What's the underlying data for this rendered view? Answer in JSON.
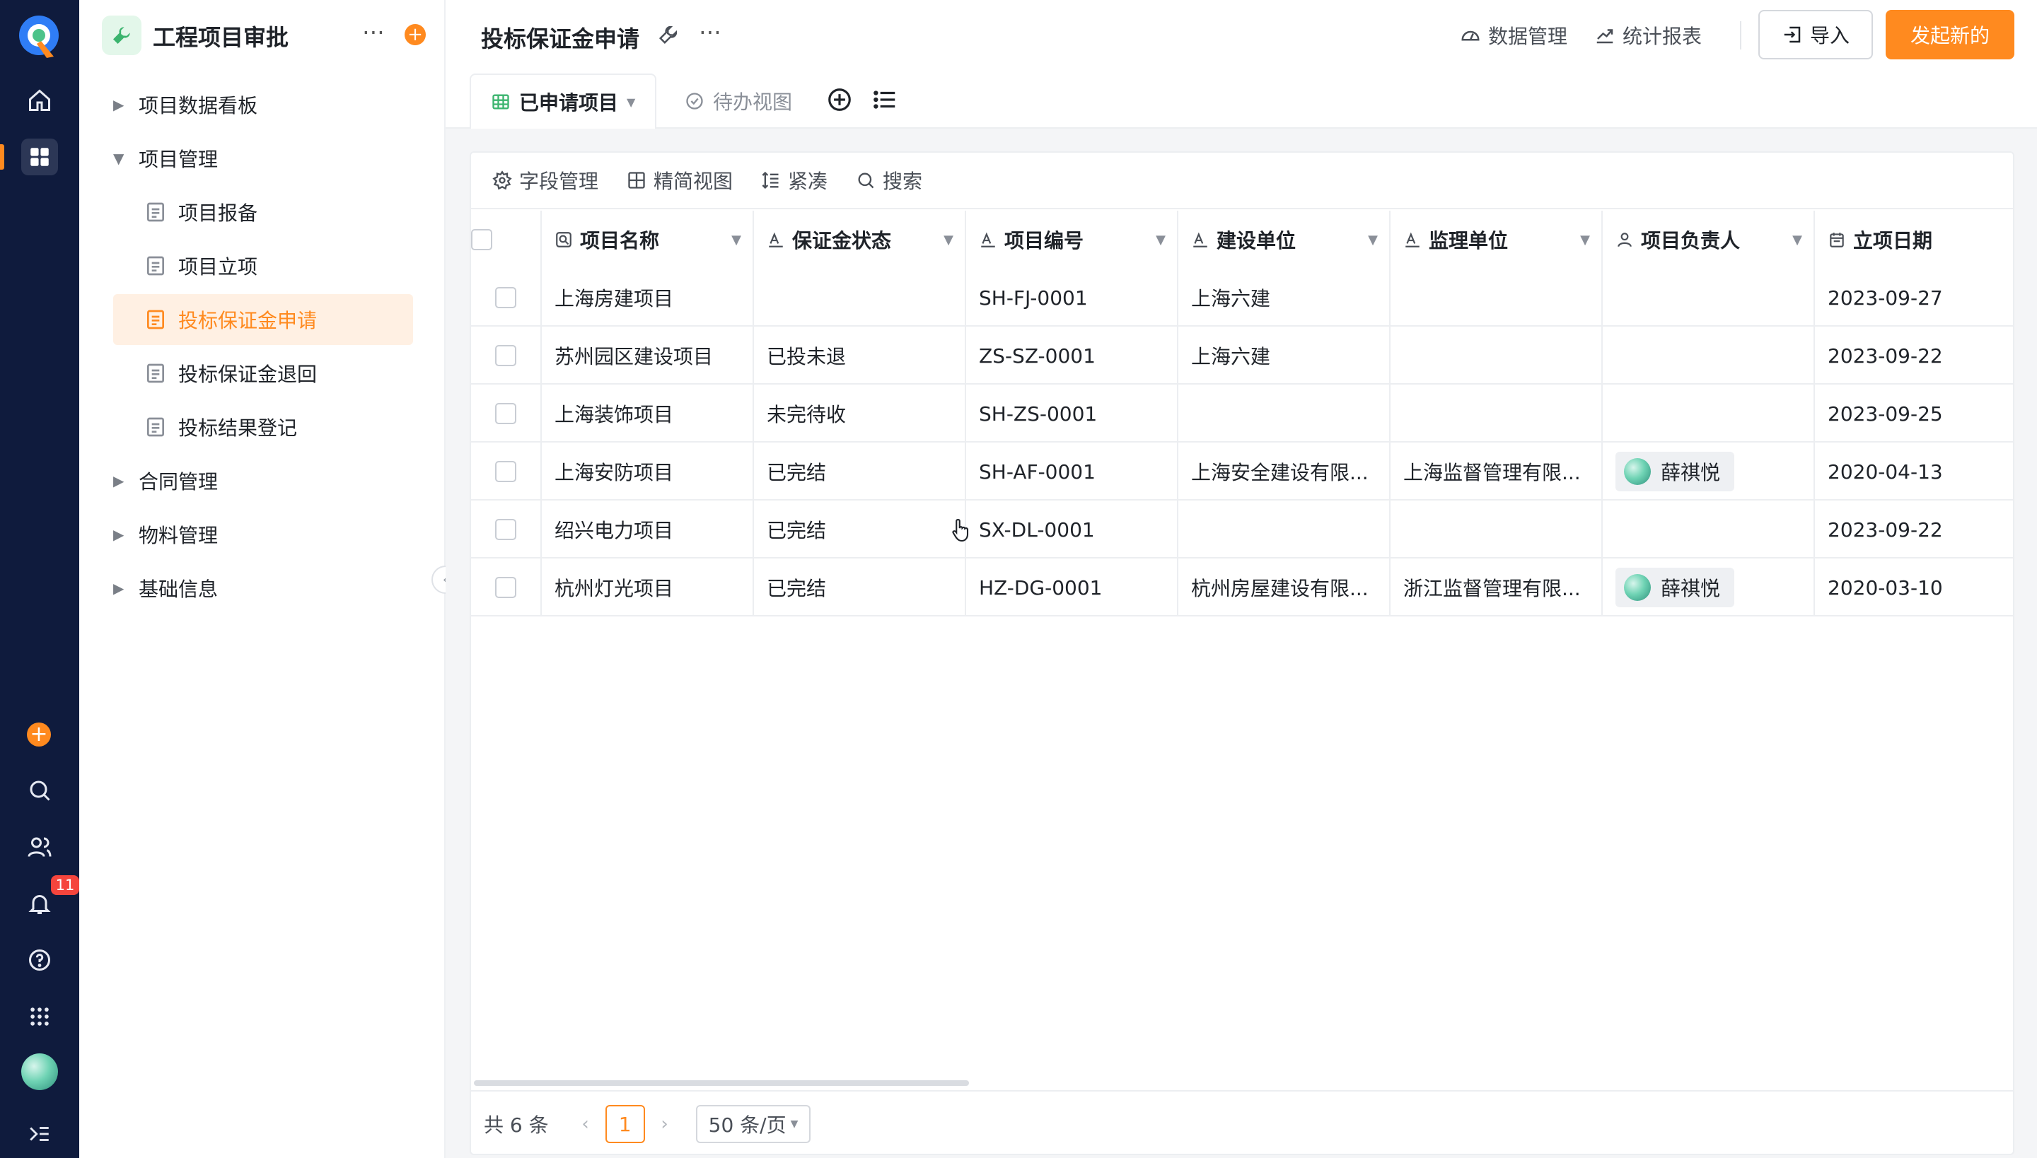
{
  "rail": {
    "notif_count": "11",
    "icons": [
      "home-icon",
      "apps-grid-icon",
      "add-icon",
      "search-icon",
      "contacts-icon",
      "bell-icon",
      "help-icon",
      "app-launcher-icon",
      "avatar",
      "expand-icon"
    ]
  },
  "sidebar": {
    "app_title": "工程项目审批",
    "items": [
      {
        "label": "项目数据看板",
        "type": "group",
        "expanded": false
      },
      {
        "label": "项目管理",
        "type": "group",
        "expanded": true
      },
      {
        "label": "项目报备",
        "type": "child"
      },
      {
        "label": "项目立项",
        "type": "child"
      },
      {
        "label": "投标保证金申请",
        "type": "child",
        "active": true
      },
      {
        "label": "投标保证金退回",
        "type": "child"
      },
      {
        "label": "投标结果登记",
        "type": "child"
      },
      {
        "label": "合同管理",
        "type": "group",
        "expanded": false
      },
      {
        "label": "物料管理",
        "type": "group",
        "expanded": false
      },
      {
        "label": "基础信息",
        "type": "group",
        "expanded": false
      }
    ]
  },
  "header": {
    "title": "投标保证金申请",
    "data_manage": "数据管理",
    "stats_report": "统计报表",
    "import_label": "导入",
    "new_label": "发起新的"
  },
  "views": {
    "tabs": [
      {
        "label": "已申请项目",
        "active": true
      },
      {
        "label": "待办视图",
        "active": false
      }
    ]
  },
  "toolbar": {
    "fields": "字段管理",
    "simple_view": "精简视图",
    "compact": "紧凑",
    "search": "搜索"
  },
  "table": {
    "columns": [
      "项目名称",
      "保证金状态",
      "项目编号",
      "建设单位",
      "监理单位",
      "项目负责人",
      "立项日期"
    ],
    "rows": [
      [
        "上海房建项目",
        "",
        "SH-FJ-0001",
        "上海六建",
        "",
        "",
        "2023-09-27"
      ],
      [
        "苏州园区建设项目",
        "已投未退",
        "ZS-SZ-0001",
        "上海六建",
        "",
        "",
        "2023-09-22"
      ],
      [
        "上海装饰项目",
        "未完待收",
        "SH-ZS-0001",
        "",
        "",
        "",
        "2023-09-25"
      ],
      [
        "上海安防项目",
        "已完结",
        "SH-AF-0001",
        "上海安全建设有限...",
        "上海监督管理有限...",
        "薛祺悦",
        "2020-04-13"
      ],
      [
        "绍兴电力项目",
        "已完结",
        "SX-DL-0001",
        "",
        "",
        "",
        "2023-09-22"
      ],
      [
        "杭州灯光项目",
        "已完结",
        "HZ-DG-0001",
        "杭州房屋建设有限...",
        "浙江监督管理有限...",
        "薛祺悦",
        "2020-03-10"
      ]
    ]
  },
  "pagination": {
    "total": "共 6 条",
    "current": "1",
    "page_size": "50 条/页"
  },
  "colors": {
    "accent": "#ff8a1f",
    "rail_bg": "#0f1b3d"
  }
}
